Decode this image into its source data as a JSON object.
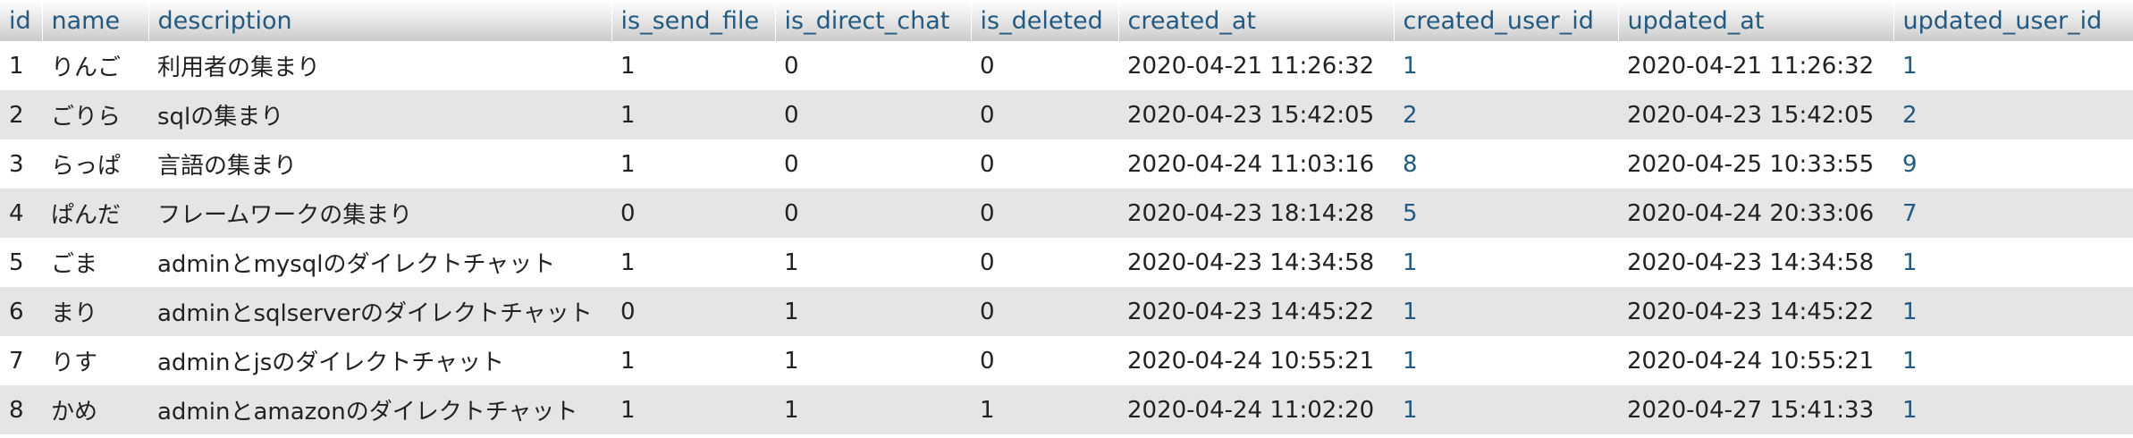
{
  "table": {
    "columns": [
      "id",
      "name",
      "description",
      "is_send_file",
      "is_direct_chat",
      "is_deleted",
      "created_at",
      "created_user_id",
      "updated_at",
      "updated_user_id"
    ],
    "rows": [
      [
        "1",
        "りんご",
        "利用者の集まり",
        "1",
        "0",
        "0",
        "2020-04-21 11:26:32",
        "1",
        "2020-04-21 11:26:32",
        "1"
      ],
      [
        "2",
        "ごりら",
        "sqlの集まり",
        "1",
        "0",
        "0",
        "2020-04-23 15:42:05",
        "2",
        "2020-04-23 15:42:05",
        "2"
      ],
      [
        "3",
        "らっぱ",
        "言語の集まり",
        "1",
        "0",
        "0",
        "2020-04-24 11:03:16",
        "8",
        "2020-04-25 10:33:55",
        "9"
      ],
      [
        "4",
        "ぱんだ",
        "フレームワークの集まり",
        "0",
        "0",
        "0",
        "2020-04-23 18:14:28",
        "5",
        "2020-04-24 20:33:06",
        "7"
      ],
      [
        "5",
        "ごま",
        "adminとmysqlのダイレクトチャット",
        "1",
        "1",
        "0",
        "2020-04-23 14:34:58",
        "1",
        "2020-04-23 14:34:58",
        "1"
      ],
      [
        "6",
        "まり",
        "adminとsqlserverのダイレクトチャット",
        "0",
        "1",
        "0",
        "2020-04-23 14:45:22",
        "1",
        "2020-04-23 14:45:22",
        "1"
      ],
      [
        "7",
        "りす",
        "adminとjsのダイレクトチャット",
        "1",
        "1",
        "0",
        "2020-04-24 10:55:21",
        "1",
        "2020-04-24 10:55:21",
        "1"
      ],
      [
        "8",
        "かめ",
        "adminとamazonのダイレクトチャット",
        "1",
        "1",
        "1",
        "2020-04-24 11:02:20",
        "1",
        "2020-04-27 15:41:33",
        "1"
      ]
    ]
  },
  "colors": {
    "header_text": "#235a81",
    "row_alt": "#e5e5e5",
    "link": "#235a81"
  }
}
